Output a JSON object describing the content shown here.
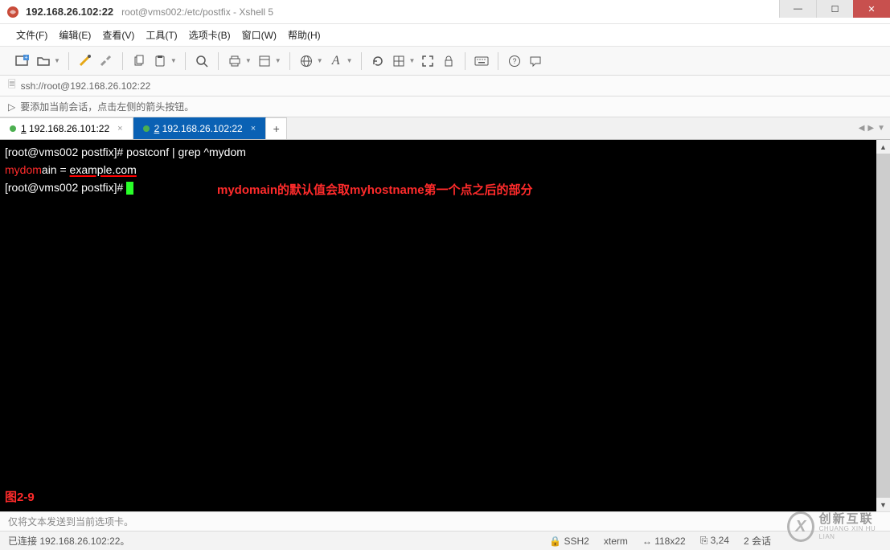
{
  "window": {
    "title_ip": "192.168.26.102:22",
    "title_path": "root@vms002:/etc/postfix - Xshell 5"
  },
  "menu": {
    "file": "文件(F)",
    "edit": "编辑(E)",
    "view": "查看(V)",
    "tools": "工具(T)",
    "tabs": "选项卡(B)",
    "window": "窗口(W)",
    "help": "帮助(H)"
  },
  "address_bar": "ssh://root@192.168.26.102:22",
  "info_bar": "要添加当前会话，点击左侧的箭头按钮。",
  "tabs": [
    {
      "num": "1",
      "label": "192.168.26.101:22",
      "active": false
    },
    {
      "num": "2",
      "label": "192.168.26.102:22",
      "active": true
    }
  ],
  "terminal": {
    "line1_prompt": "[root@vms002 postfix]# ",
    "line1_cmd": "postconf | grep ^mydom",
    "line2_key": "mydom",
    "line2_rest": "ain = ",
    "line2_val": "example.com",
    "line3_prompt": "[root@vms002 postfix]# ",
    "annotation_main": "mydomain的默认值会取myhostname第一个点之后的部分",
    "annotation_fig": "图2-9"
  },
  "footer_hint": "仅将文本发送到当前选项卡。",
  "status": {
    "conn": "已连接 192.168.26.102:22。",
    "ssh": "SSH2",
    "term": "xterm",
    "size": "118x22",
    "pos": "3,24",
    "sessions": "2 会话"
  },
  "watermark": {
    "brand": "创新互联",
    "sub": "CHUANG XIN HU LIAN"
  }
}
